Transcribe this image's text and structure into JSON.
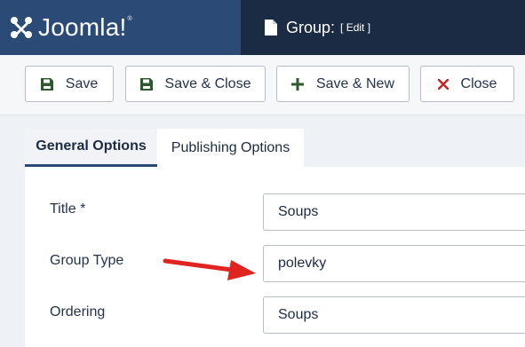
{
  "header": {
    "brand": "Joomla!",
    "brand_mark": "®",
    "title": "Group:",
    "title_sub": "[ Edit ]"
  },
  "toolbar": {
    "save_label": "Save",
    "save_close_label": "Save & Close",
    "save_new_label": "Save & New",
    "close_label": "Close"
  },
  "tabs": {
    "general": "General Options",
    "publishing": "Publishing Options"
  },
  "form": {
    "title_label": "Title *",
    "title_value": "Soups",
    "group_type_label": "Group Type",
    "group_type_value": "polevky",
    "ordering_label": "Ordering",
    "ordering_value": "Soups"
  },
  "colors": {
    "brand_bg": "#2c4a76",
    "titlebar_bg": "#1c2b44",
    "close_icon": "#c52827",
    "save_icon": "#2e5a2e",
    "arrow": "#e0241f"
  },
  "icons": {
    "brand": "joomla-logo-icon",
    "title": "file-icon",
    "save": "floppy-disk-icon",
    "save_close": "floppy-disk-icon",
    "save_new": "plus-icon",
    "close": "close-icon"
  }
}
